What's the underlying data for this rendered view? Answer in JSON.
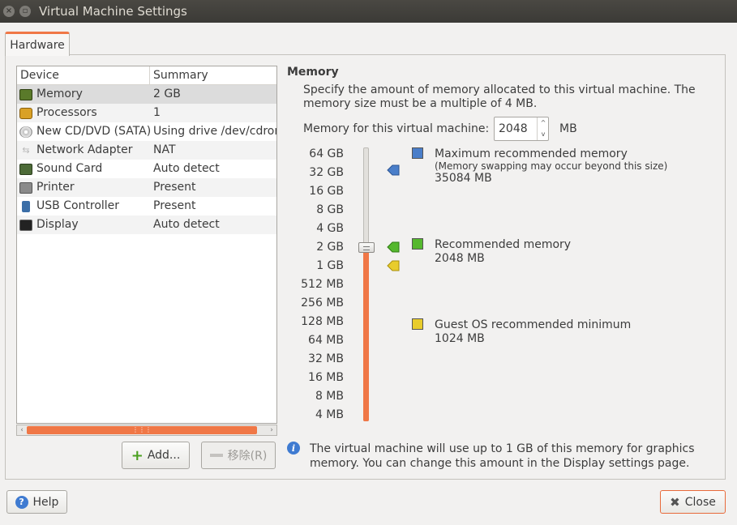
{
  "window": {
    "title": "Virtual Machine Settings",
    "close_glyph": "×",
    "max_glyph": "▫"
  },
  "tabs": [
    {
      "label": "Hardware"
    }
  ],
  "device_list": {
    "columns": [
      "Device",
      "Summary"
    ],
    "rows": [
      {
        "device": "Memory",
        "summary": "2 GB",
        "icon": "memory-icon"
      },
      {
        "device": "Processors",
        "summary": "1",
        "icon": "processor-icon"
      },
      {
        "device": "New CD/DVD (SATA)",
        "summary": "Using drive /dev/cdrom",
        "icon": "cd-dvd-icon"
      },
      {
        "device": "Network Adapter",
        "summary": "NAT",
        "icon": "network-icon"
      },
      {
        "device": "Sound Card",
        "summary": "Auto detect",
        "icon": "sound-card-icon"
      },
      {
        "device": "Printer",
        "summary": "Present",
        "icon": "printer-icon"
      },
      {
        "device": "USB Controller",
        "summary": "Present",
        "icon": "usb-icon"
      },
      {
        "device": "Display",
        "summary": "Auto detect",
        "icon": "display-icon"
      }
    ]
  },
  "buttons": {
    "add": "Add...",
    "remove": "移除(R)",
    "help": "Help",
    "close": "Close"
  },
  "memory": {
    "title": "Memory",
    "description": "Specify the amount of memory allocated to this virtual machine. The memory size must be a multiple of 4 MB.",
    "field_label": "Memory for this virtual machine:",
    "value": "2048",
    "unit": "MB",
    "scale": [
      "64 GB",
      "32 GB",
      "16 GB",
      "8 GB",
      "4 GB",
      "2 GB",
      "1 GB",
      "512 MB",
      "256 MB",
      "128 MB",
      "64 MB",
      "32 MB",
      "16 MB",
      "8 MB",
      "4 MB"
    ],
    "max_rec": {
      "title": "Maximum recommended memory",
      "note": "(Memory swapping may occur beyond this size)",
      "value": "35084 MB",
      "color": "#4a7ec9"
    },
    "rec": {
      "title": "Recommended memory",
      "value": "2048 MB",
      "color": "#55b82e"
    },
    "min": {
      "title": "Guest OS recommended minimum",
      "value": "1024 MB",
      "color": "#e8cc2c"
    },
    "info": "The virtual machine will use up to 1 GB of this memory for graphics memory. You can change this amount in the Display settings page."
  },
  "colors": {
    "accent": "#f07746"
  }
}
